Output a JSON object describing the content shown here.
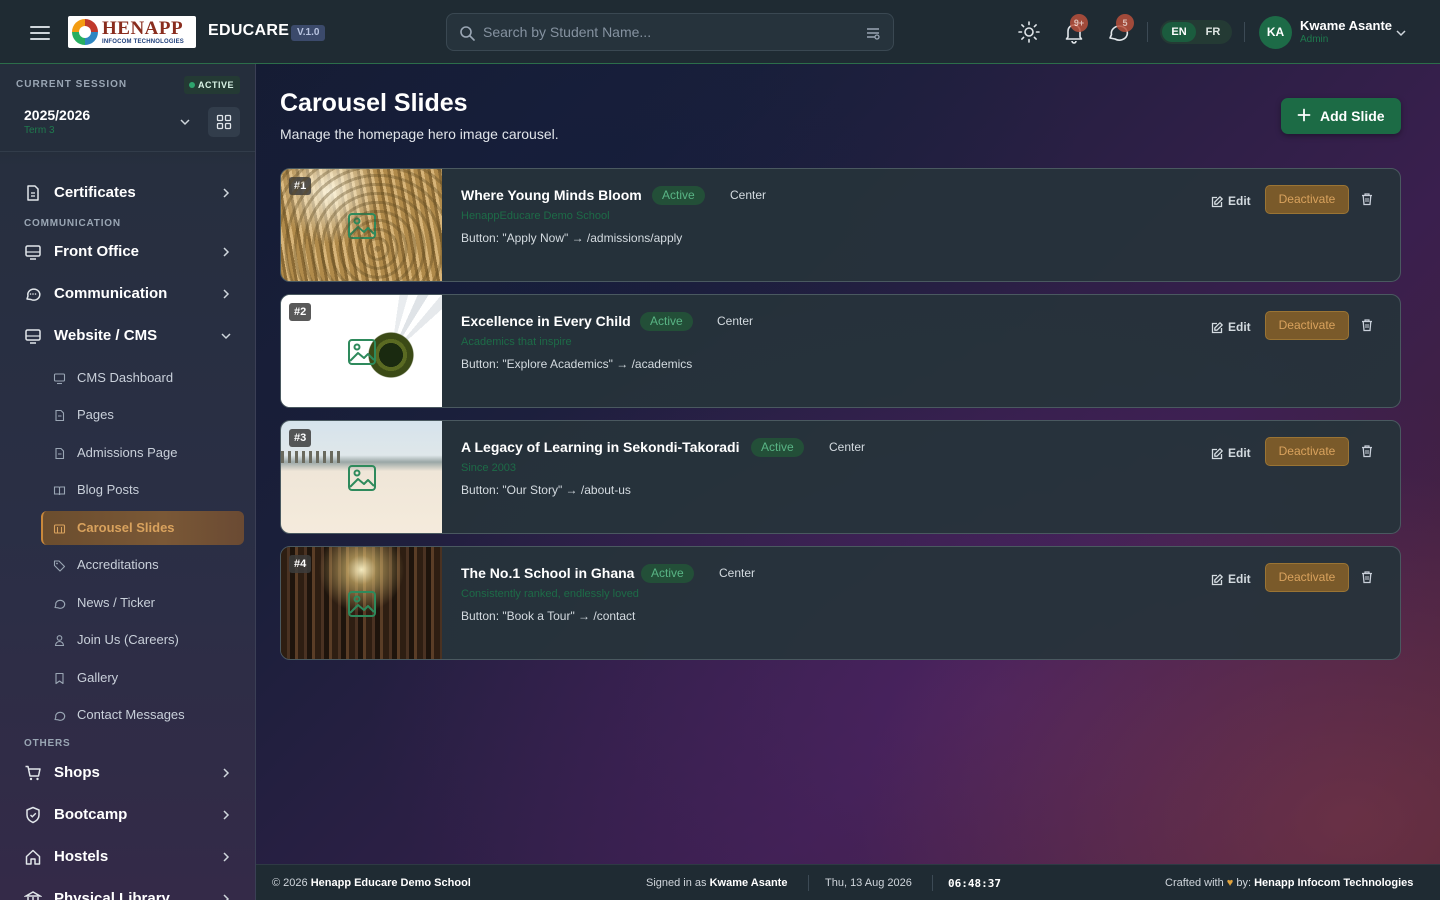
{
  "header": {
    "logo_brand": "HENAPP",
    "logo_tagline": "INFOCOM TECHNOLOGIES",
    "app_name": "EDUCARE",
    "version": "V.1.0",
    "search_placeholder": "Search by Student Name...",
    "notifications_count": "9+",
    "messages_count": "5",
    "languages": [
      "EN",
      "FR"
    ],
    "active_language": "EN",
    "user": {
      "initials": "KA",
      "name": "Kwame Asante",
      "role": "Admin"
    }
  },
  "sidebar": {
    "session_label": "CURRENT SESSION",
    "session_status": "ACTIVE",
    "session_year": "2025/2026",
    "session_term": "Term 3",
    "nav_top": [
      {
        "label": "Certificates",
        "icon": "certificate-icon"
      }
    ],
    "section_communication": "COMMUNICATION",
    "nav_communication": [
      {
        "label": "Front Office",
        "icon": "monitor-icon"
      },
      {
        "label": "Communication",
        "icon": "chat-icon"
      },
      {
        "label": "Website / CMS",
        "icon": "monitor-icon",
        "expanded": true
      }
    ],
    "cms_items": [
      {
        "label": "CMS Dashboard",
        "icon": "monitor-icon"
      },
      {
        "label": "Pages",
        "icon": "document-icon"
      },
      {
        "label": "Admissions Page",
        "icon": "document-icon"
      },
      {
        "label": "Blog Posts",
        "icon": "book-icon"
      },
      {
        "label": "Carousel Slides",
        "icon": "slides-icon",
        "active": true
      },
      {
        "label": "Accreditations",
        "icon": "tag-icon"
      },
      {
        "label": "News / Ticker",
        "icon": "chat-icon"
      },
      {
        "label": "Join Us (Careers)",
        "icon": "user-icon"
      },
      {
        "label": "Gallery",
        "icon": "bookmark-icon"
      },
      {
        "label": "Contact Messages",
        "icon": "chat-icon"
      }
    ],
    "section_others": "OTHERS",
    "nav_others": [
      {
        "label": "Shops",
        "icon": "cart-icon"
      },
      {
        "label": "Bootcamp",
        "icon": "shield-icon"
      },
      {
        "label": "Hostels",
        "icon": "home-icon"
      },
      {
        "label": "Physical Library",
        "icon": "library-icon"
      }
    ]
  },
  "main": {
    "title": "Carousel Slides",
    "subtitle": "Manage the homepage hero image carousel.",
    "add_button": "Add Slide",
    "edit_label": "Edit",
    "deactivate_label": "Deactivate",
    "slides": [
      {
        "num": "#1",
        "title": "Where Young Minds Bloom",
        "status": "Active",
        "alignment": "Center",
        "subtitle": "HenappEducare Demo School",
        "button_info": "Button: \"Apply Now\" → /admissions/apply"
      },
      {
        "num": "#2",
        "title": "Excellence in Every Child",
        "status": "Active",
        "alignment": "Center",
        "subtitle": "Academics that inspire",
        "button_info": "Button: \"Explore Academics\" → /academics"
      },
      {
        "num": "#3",
        "title": "A Legacy of Learning in Sekondi-Takoradi",
        "status": "Active",
        "alignment": "Center",
        "subtitle": "Since 2003",
        "button_info": "Button: \"Our Story\" → /about-us"
      },
      {
        "num": "#4",
        "title": "The No.1 School in Ghana",
        "status": "Active",
        "alignment": "Center",
        "subtitle": "Consistently ranked, endlessly loved",
        "button_info": "Button: \"Book a Tour\" → /contact"
      }
    ]
  },
  "footer": {
    "copyright_prefix": "© 2026",
    "school_name": "Henapp Educare Demo School",
    "signed_in_prefix": "Signed in as",
    "signed_in_user": "Kwame Asante",
    "date": "Thu, 13 Aug 2026",
    "time": "06:48:37",
    "crafted_prefix": "Crafted with",
    "crafted_by": "by:",
    "company": "Henapp Infocom Technologies"
  },
  "colors": {
    "accent_green": "#1c6b45",
    "active_pill_text": "#59b585",
    "deactivate_bg": "#7a5a2a",
    "deactivate_text": "#d9a25d",
    "sidebar_active": "#7a5836"
  }
}
